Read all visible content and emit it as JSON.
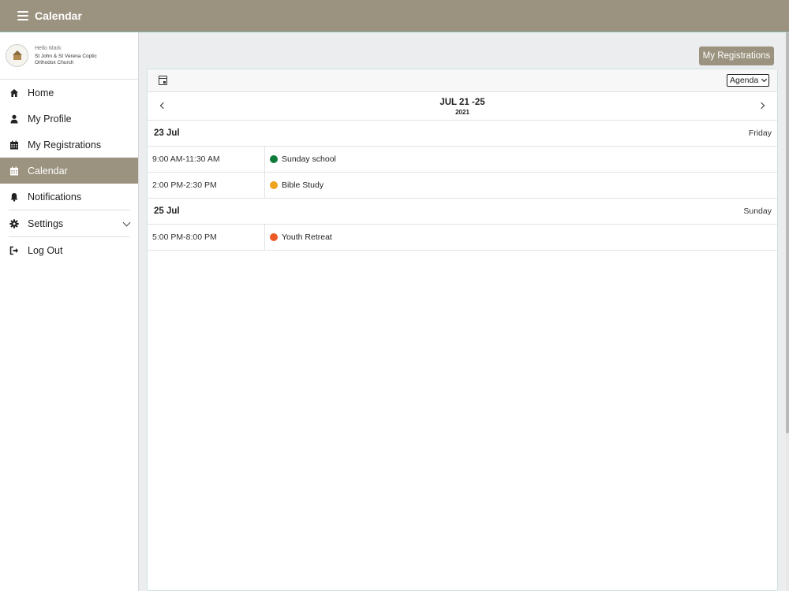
{
  "header": {
    "title": "Calendar"
  },
  "profile": {
    "greeting": "Hello Mark",
    "church": "St John & St Verena Coptic Orthodox Church"
  },
  "sidebar": {
    "items": [
      {
        "label": "Home",
        "icon": "home-icon"
      },
      {
        "label": "My Profile",
        "icon": "user-icon"
      },
      {
        "label": "My Registrations",
        "icon": "calendar-icon"
      },
      {
        "label": "Calendar",
        "icon": "calendar-icon",
        "active": true
      },
      {
        "label": "Notifications",
        "icon": "bell-icon"
      },
      {
        "label": "Settings",
        "icon": "gear-icon"
      },
      {
        "label": "Log Out",
        "icon": "sign-out-icon"
      }
    ]
  },
  "main": {
    "my_registrations_label": "My Registrations"
  },
  "calendar": {
    "view": "Agenda",
    "range": "JUL 21 -25",
    "year": "2021",
    "days": [
      {
        "date": "23 Jul",
        "weekday": "Friday",
        "events": [
          {
            "time": "9:00 AM-11:30 AM",
            "title": "Sunday school",
            "color": "#0e7a3c"
          },
          {
            "time": "2:00 PM-2:30 PM",
            "title": "Bible Study",
            "color": "#f0a21f"
          }
        ]
      },
      {
        "date": "25 Jul",
        "weekday": "Sunday",
        "events": [
          {
            "time": "5:00 PM-8:00 PM",
            "title": "Youth Retreat",
            "color": "#ee5a24"
          }
        ]
      }
    ]
  },
  "colors": {
    "accent": "#9b927f",
    "border_teal": "#7fb5ad"
  }
}
